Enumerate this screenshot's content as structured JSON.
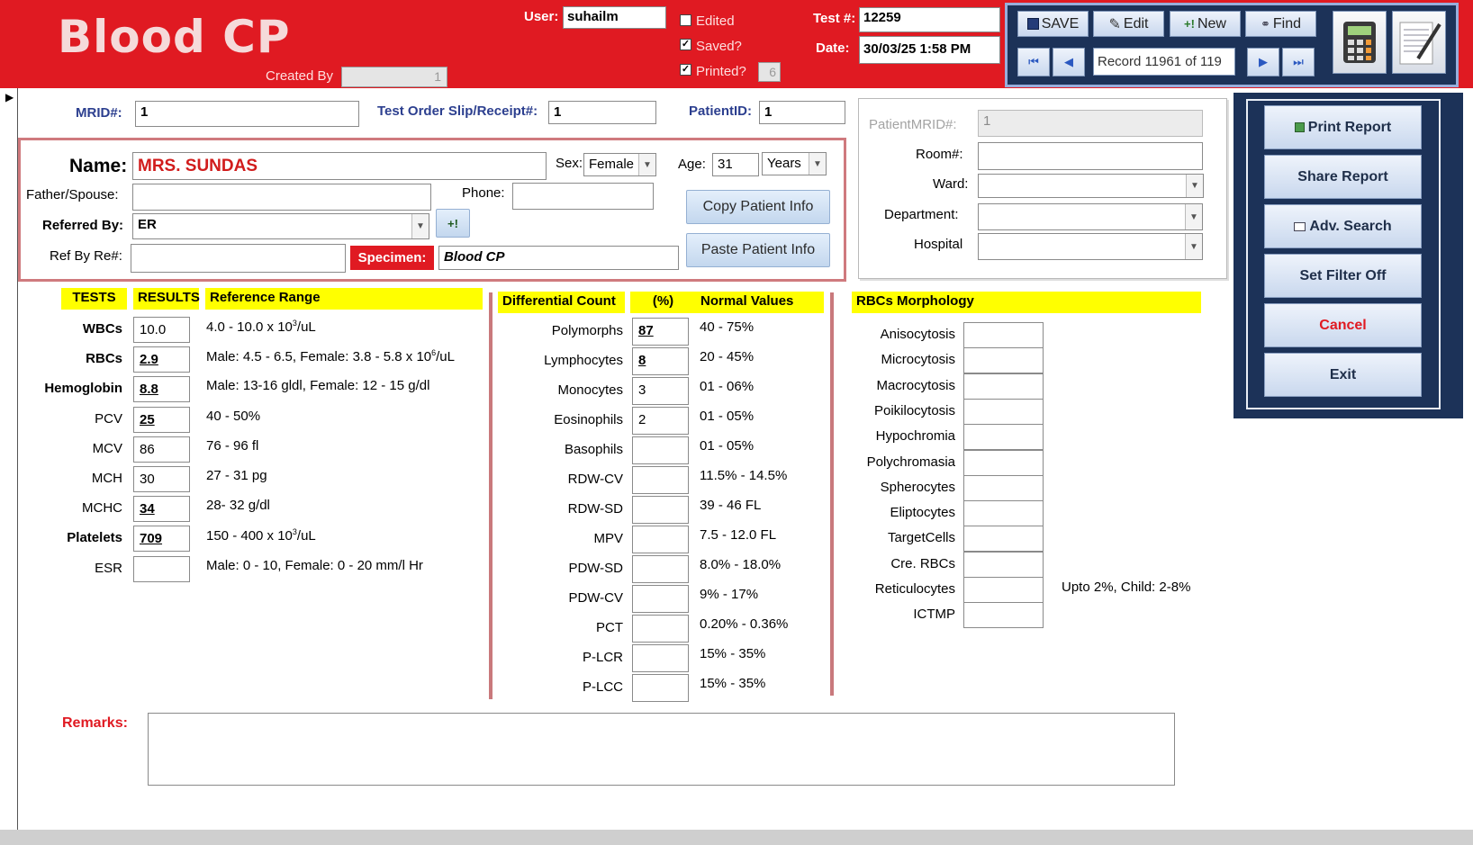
{
  "header": {
    "title": "Blood CP",
    "user_label": "User:",
    "user_value": "suhailm",
    "created_by_label": "Created By",
    "created_by_value": "1",
    "edited_label": "Edited",
    "saved_label": "Saved?",
    "printed_label": "Printed?",
    "printed_count": "6",
    "test_no_label": "Test #:",
    "test_no_value": "12259",
    "date_label": "Date:",
    "date_value": "30/03/25 1:58 PM"
  },
  "toolbar": {
    "save": "SAVE",
    "edit": "Edit",
    "new": "New",
    "find": "Find",
    "record": "Record 11961 of 119"
  },
  "side_actions": {
    "print": "Print Report",
    "share": "Share Report",
    "adv_search": "Adv. Search",
    "filter": "Set Filter Off",
    "cancel": "Cancel",
    "exit": "Exit"
  },
  "ids": {
    "mrid_label": "MRID#:",
    "mrid_value": "1",
    "slip_label": "Test Order Slip/Receipt#:",
    "slip_value": "1",
    "patientid_label": "PatientID:",
    "patientid_value": "1"
  },
  "patient": {
    "name_label": "Name:",
    "name_value": "MRS. SUNDAS",
    "sex_label": "Sex:",
    "sex_value": "Female",
    "age_label": "Age:",
    "age_value": "31",
    "age_unit": "Years",
    "father_label": "Father/Spouse:",
    "phone_label": "Phone:",
    "referred_label": "Referred By:",
    "referred_value": "ER",
    "refby_label": "Ref By Re#:",
    "specimen_label": "Specimen:",
    "specimen_value": "Blood CP",
    "copy_button": "Copy Patient Info",
    "paste_button": "Paste Patient Info",
    "add_ref_button": "+!"
  },
  "location": {
    "patient_mrid_label": "PatientMRID#:",
    "patient_mrid_value": "1",
    "room_label": "Room#:",
    "ward_label": "Ward:",
    "department_label": "Department:",
    "hospital_label": "Hospital"
  },
  "tests": {
    "headers": {
      "tests": "TESTS",
      "results": "RESULTS",
      "reference": "Reference Range"
    },
    "rows": [
      {
        "name": "WBCs",
        "value": "10.0",
        "ref": "4.0 - 10.0 x 10",
        "ref_sup": "3",
        "ref_tail": "/uL"
      },
      {
        "name": "RBCs",
        "value": "2.9",
        "ref": "Male: 4.5 - 6.5,  Female: 3.8 - 5.8 x 10",
        "ref_sup": "6",
        "ref_tail": "/uL"
      },
      {
        "name": "Hemoglobin",
        "value": "8.8",
        "ref": "Male: 13-16 gldl, Female: 12 - 15 g/dl",
        "ref_sup": "",
        "ref_tail": ""
      },
      {
        "name": "PCV",
        "value": "25",
        "ref": "40 - 50%",
        "ref_sup": "",
        "ref_tail": ""
      },
      {
        "name": "MCV",
        "value": "86",
        "ref": "76 - 96 fl",
        "ref_sup": "",
        "ref_tail": ""
      },
      {
        "name": "MCH",
        "value": "30",
        "ref": "27 - 31 pg",
        "ref_sup": "",
        "ref_tail": ""
      },
      {
        "name": "MCHC",
        "value": "34",
        "ref": "28- 32 g/dl",
        "ref_sup": "",
        "ref_tail": ""
      },
      {
        "name": "Platelets",
        "value": "709",
        "ref": "150 - 400 x 10",
        "ref_sup": "3",
        "ref_tail": "/uL"
      },
      {
        "name": "ESR",
        "value": "",
        "ref": "Male: 0 - 10, Female: 0 - 20  mm/l Hr",
        "ref_sup": "",
        "ref_tail": ""
      }
    ]
  },
  "differential": {
    "headers": {
      "name": "Differential Count",
      "pct": "(%)",
      "normal": "Normal Values"
    },
    "rows": [
      {
        "name": "Polymorphs",
        "value": "87",
        "normal": "40 - 75%"
      },
      {
        "name": "Lymphocytes",
        "value": "8",
        "normal": "20 - 45%"
      },
      {
        "name": "Monocytes",
        "value": "3",
        "normal": "01 - 06%"
      },
      {
        "name": "Eosinophils",
        "value": "2",
        "normal": "01 - 05%"
      },
      {
        "name": "Basophils",
        "value": "",
        "normal": "01 - 05%"
      },
      {
        "name": "RDW-CV",
        "value": "",
        "normal": "11.5% - 14.5%"
      },
      {
        "name": "RDW-SD",
        "value": "",
        "normal": "39 - 46 FL"
      },
      {
        "name": "MPV",
        "value": "",
        "normal": "7.5  - 12.0 FL"
      },
      {
        "name": "PDW-SD",
        "value": "",
        "normal": "8.0% - 18.0%"
      },
      {
        "name": "PDW-CV",
        "value": "",
        "normal": "9% - 17%"
      },
      {
        "name": "PCT",
        "value": "",
        "normal": "0.20% - 0.36%"
      },
      {
        "name": "P-LCR",
        "value": "",
        "normal": "15% - 35%"
      },
      {
        "name": "P-LCC",
        "value": "",
        "normal": "15% - 35%"
      }
    ]
  },
  "morphology": {
    "header": "RBCs Morphology",
    "rows": [
      "Anisocytosis",
      "Microcytosis",
      "Macrocytosis",
      "Poikilocytosis",
      "Hypochromia",
      "Polychromasia",
      "Spherocytes",
      "Eliptocytes",
      "TargetCells",
      "Cre. RBCs",
      "Reticulocytes",
      "ICTMP"
    ],
    "reticulocytes_note": "Upto 2%, Child: 2-8%"
  },
  "remarks_label": "Remarks:",
  "colors": {
    "header_red": "#e01a22",
    "nav_navy": "#1c3258",
    "highlight_yellow": "#ffff00",
    "label_red": "#e01a22"
  }
}
